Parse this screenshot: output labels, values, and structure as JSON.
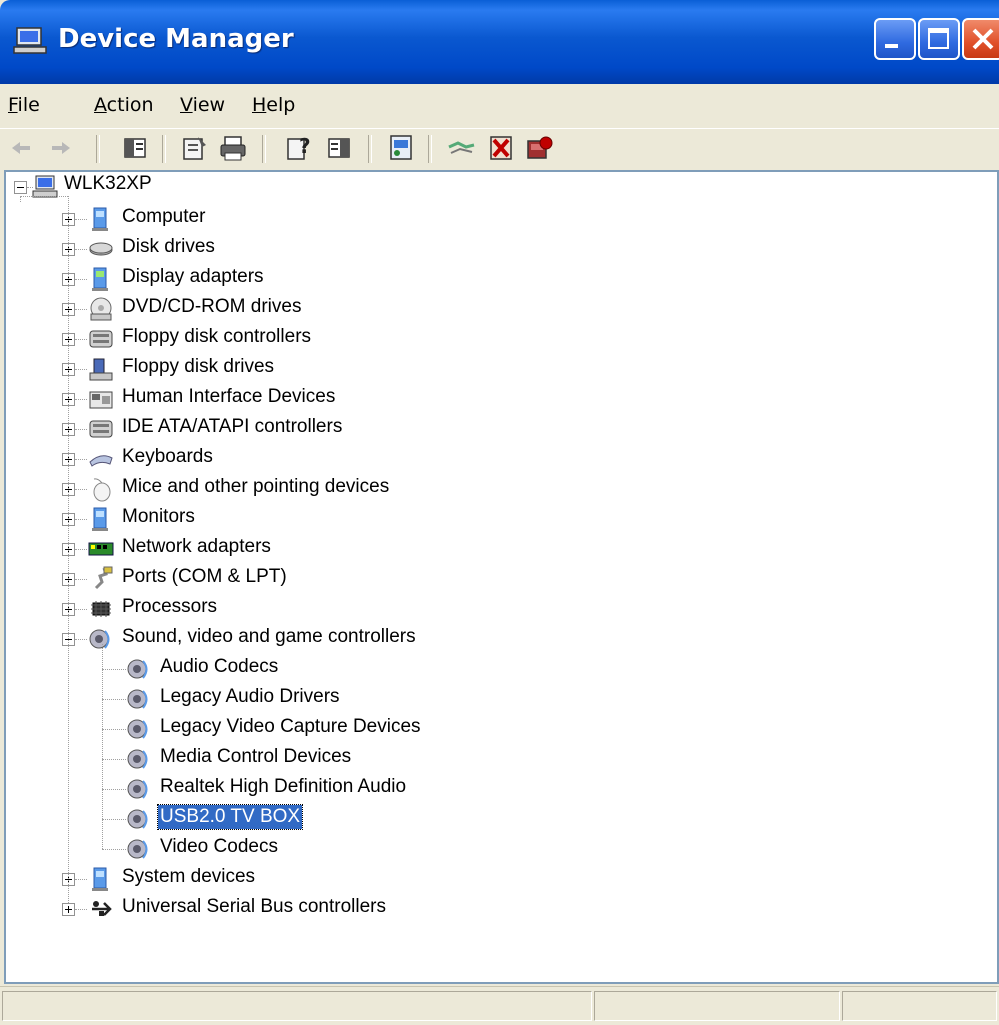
{
  "window": {
    "title": "Device Manager"
  },
  "menu": [
    {
      "pre": "",
      "key": "F",
      "post": "ile"
    },
    {
      "pre": "",
      "key": "A",
      "post": "ction"
    },
    {
      "pre": "",
      "key": "V",
      "post": "iew"
    },
    {
      "pre": "",
      "key": "H",
      "post": "elp"
    }
  ],
  "toolbar": [
    "back-icon",
    "forward-icon",
    "show-hide-console-tree-icon",
    "properties-icon",
    "print-icon",
    "help-icon",
    "show-hide-action-pane-icon",
    "scan-hardware-icon",
    "update-driver-icon",
    "uninstall-icon",
    "disable-icon"
  ],
  "tree": {
    "root": "WLK32XP",
    "categories": [
      {
        "label": "Computer",
        "icon": "computer-icon"
      },
      {
        "label": "Disk drives",
        "icon": "disk-drive-icon"
      },
      {
        "label": "Display adapters",
        "icon": "display-adapter-icon"
      },
      {
        "label": "DVD/CD-ROM drives",
        "icon": "dvd-drive-icon"
      },
      {
        "label": "Floppy disk controllers",
        "icon": "floppy-controller-icon"
      },
      {
        "label": "Floppy disk drives",
        "icon": "floppy-drive-icon"
      },
      {
        "label": "Human Interface Devices",
        "icon": "hid-icon"
      },
      {
        "label": "IDE ATA/ATAPI controllers",
        "icon": "ide-controller-icon"
      },
      {
        "label": "Keyboards",
        "icon": "keyboard-icon"
      },
      {
        "label": "Mice and other pointing devices",
        "icon": "mouse-icon"
      },
      {
        "label": "Monitors",
        "icon": "monitor-icon"
      },
      {
        "label": "Network adapters",
        "icon": "network-adapter-icon"
      },
      {
        "label": "Ports (COM & LPT)",
        "icon": "port-icon"
      },
      {
        "label": "Processors",
        "icon": "processor-icon"
      },
      {
        "label": "Sound, video and game controllers",
        "icon": "sound-icon",
        "expanded": true
      },
      {
        "label": "System devices",
        "icon": "system-device-icon"
      },
      {
        "label": "Universal Serial Bus controllers",
        "icon": "usb-icon"
      }
    ],
    "sound_children": [
      {
        "label": "Audio Codecs"
      },
      {
        "label": "Legacy Audio Drivers"
      },
      {
        "label": "Legacy Video Capture Devices"
      },
      {
        "label": "Media Control Devices"
      },
      {
        "label": "Realtek High Definition Audio"
      },
      {
        "label": "USB2.0 TV BOX",
        "selected": true
      },
      {
        "label": "Video Codecs"
      }
    ]
  },
  "statusbar": {
    "cells": [
      "",
      "",
      ""
    ]
  }
}
